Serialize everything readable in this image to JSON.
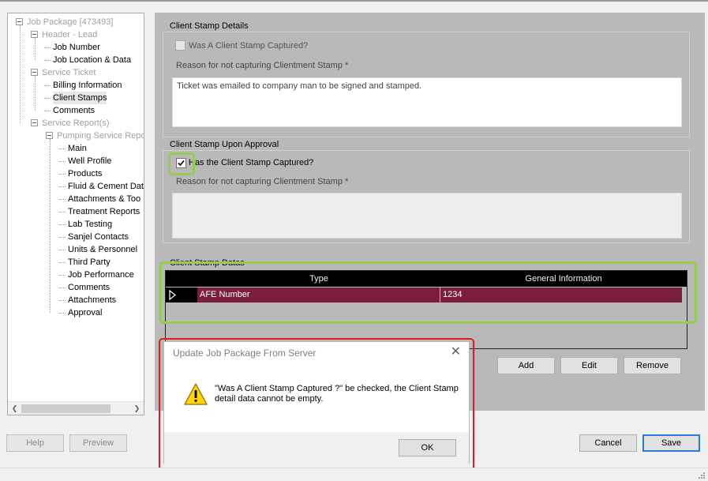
{
  "tree": {
    "items": [
      {
        "label": "Job Package [473493]",
        "level": 0,
        "disabled": true,
        "expander": true
      },
      {
        "label": "Header - Lead",
        "level": 1,
        "disabled": true,
        "expander": true
      },
      {
        "label": "Job Number",
        "level": 2,
        "disabled": false
      },
      {
        "label": "Job Location & Data",
        "level": 2,
        "disabled": false
      },
      {
        "label": "Service Ticket",
        "level": 1,
        "disabled": true,
        "expander": true
      },
      {
        "label": "Billing Information",
        "level": 2,
        "disabled": false
      },
      {
        "label": "Client Stamps",
        "level": 2,
        "disabled": false,
        "selected": true
      },
      {
        "label": "Comments",
        "level": 2,
        "disabled": false
      },
      {
        "label": "Service Report(s)",
        "level": 1,
        "disabled": true,
        "expander": true
      },
      {
        "label": "Pumping Service Repo",
        "level": 2,
        "disabled": true,
        "expander": true
      },
      {
        "label": "Main",
        "level": 3,
        "disabled": false
      },
      {
        "label": "Well Profile",
        "level": 3,
        "disabled": false
      },
      {
        "label": "Products",
        "level": 3,
        "disabled": false
      },
      {
        "label": "Fluid & Cement Dat",
        "level": 3,
        "disabled": false
      },
      {
        "label": "Attachments & Too",
        "level": 3,
        "disabled": false
      },
      {
        "label": "Treatment Reports",
        "level": 3,
        "disabled": false
      },
      {
        "label": "Lab Testing",
        "level": 3,
        "disabled": false
      },
      {
        "label": "Sanjel Contacts",
        "level": 3,
        "disabled": false
      },
      {
        "label": "Units & Personnel",
        "level": 3,
        "disabled": false
      },
      {
        "label": "Third Party",
        "level": 3,
        "disabled": false
      },
      {
        "label": "Job Performance",
        "level": 3,
        "disabled": false
      },
      {
        "label": "Comments",
        "level": 3,
        "disabled": false
      },
      {
        "label": "Attachments",
        "level": 3,
        "disabled": false
      },
      {
        "label": "Approval",
        "level": 3,
        "disabled": false
      }
    ]
  },
  "details": {
    "title": "Client Stamp Details",
    "checkbox_label": "Was A Client Stamp Captured?",
    "checked": false,
    "reason_label": "Reason for not capturing Clientment Stamp *",
    "reason_value": "Ticket was emailed to company man to be signed and stamped."
  },
  "approval": {
    "title": "Client Stamp Upon Approval",
    "checkbox_label": "Has the Client Stamp Captured?",
    "checked": true,
    "reason_label": "Reason for not capturing Clientment Stamp  *",
    "reason_value": ""
  },
  "datas": {
    "title": "Client Stamp Datas",
    "columns": [
      "Type",
      "General Information"
    ],
    "rows": [
      [
        "AFE Number",
        "1234"
      ]
    ],
    "add_label": "Add",
    "edit_label": "Edit",
    "remove_label": "Remove"
  },
  "dialog": {
    "title": "Update Job Package From Server",
    "message": "\"Was A Client Stamp Captured ?\" be checked,  the Client Stamp detail data cannot be empty.",
    "ok_label": "OK"
  },
  "footer": {
    "help_label": "Help",
    "preview_label": "Preview",
    "cancel_label": "Cancel",
    "save_label": "Save"
  },
  "colors": {
    "selected_row": "#7b1e3c",
    "highlight_green": "#96cc4f",
    "highlight_red": "#e11b1b",
    "default_button_border": "#2b7cd3"
  }
}
